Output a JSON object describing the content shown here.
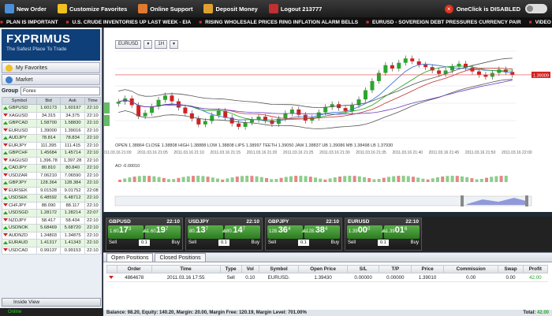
{
  "topbar": {
    "items": [
      {
        "label": "New Order",
        "icon": "new-order-icon",
        "color": "#4a8fd8"
      },
      {
        "label": "Customize Favorites",
        "icon": "star-icon",
        "color": "#f0c020"
      },
      {
        "label": "Online Support",
        "icon": "support-icon",
        "color": "#e07a30"
      },
      {
        "label": "Deposit Money",
        "icon": "deposit-icon",
        "color": "#e0a030"
      },
      {
        "label": "Logout 213777",
        "icon": "logout-icon",
        "color": "#c03030"
      }
    ],
    "oneclick_status": "OneClick is DISABLED"
  },
  "ticker": [
    "PLAN IS IMPORTANT",
    "U.S. CRUDE INVENTORIES UP LAST WEEK - EIA",
    "RISING WHOLESALE PRICES RING INFLATION ALARM BELLS",
    "EURUSD - SOVEREIGN DEBT PRESSURES CURRENCY PAIR",
    "VIDEO HOW SUBMIT YOUR STORY TO FO"
  ],
  "sidebar": {
    "brand": "FXPRIMUS",
    "tagline": "The Safest Place To Trade",
    "favorites_label": "My Favorites",
    "market_label": "Market",
    "group_label": "Group",
    "group_value": "Forex",
    "columns": [
      "Symbol",
      "Bid",
      "Ask",
      "Time"
    ],
    "rows": [
      {
        "dir": "up",
        "symbol": "GBPUSD",
        "bid": "1.60173",
        "ask": "1.60197",
        "time": "22:10"
      },
      {
        "dir": "down",
        "symbol": "XAGUSD",
        "bid": "34.315",
        "ask": "34.375",
        "time": "22:10"
      },
      {
        "dir": "up",
        "symbol": "GBPCAD",
        "bid": "1.58700",
        "ask": "1.58830",
        "time": "22:10"
      },
      {
        "dir": "down",
        "symbol": "EURUSD",
        "bid": "1.39000",
        "ask": "1.39016",
        "time": "22:10"
      },
      {
        "dir": "up",
        "symbol": "AUDJPY",
        "bid": "78.814",
        "ask": "78.834",
        "time": "22:10"
      },
      {
        "dir": "down",
        "symbol": "EURJPY",
        "bid": "111.395",
        "ask": "111.415",
        "time": "22:10"
      },
      {
        "dir": "up",
        "symbol": "GBPCHF",
        "bid": "1.45684",
        "ask": "1.45714",
        "time": "22:10"
      },
      {
        "dir": "down",
        "symbol": "XAGUSD",
        "bid": "1,396.78",
        "ask": "1,397.28",
        "time": "22:10"
      },
      {
        "dir": "up",
        "symbol": "CADJPY",
        "bid": "80.810",
        "ask": "80.840",
        "time": "22:10"
      },
      {
        "dir": "down",
        "symbol": "USDZAR",
        "bid": "7.06210",
        "ask": "7.06590",
        "time": "22:10"
      },
      {
        "dir": "up",
        "symbol": "GBPJPY",
        "bid": "128.364",
        "ask": "128.384",
        "time": "22:10"
      },
      {
        "dir": "down",
        "symbol": "EURSEK",
        "bid": "9.01528",
        "ask": "9.01752",
        "time": "22:08"
      },
      {
        "dir": "up",
        "symbol": "USDSEK",
        "bid": "6.48592",
        "ask": "6.48712",
        "time": "22:10"
      },
      {
        "dir": "down",
        "symbol": "CHFJPY",
        "bid": "88.090",
        "ask": "88.117",
        "time": "22:10"
      },
      {
        "dir": "up",
        "symbol": "USDSGD",
        "bid": "1.28172",
        "ask": "1.28214",
        "time": "22:07"
      },
      {
        "dir": "down",
        "symbol": "NZDJPY",
        "bid": "58.417",
        "ask": "58.434",
        "time": "22:10"
      },
      {
        "dir": "up",
        "symbol": "USDNOK",
        "bid": "5.68469",
        "ask": "5.68720",
        "time": "22:10"
      },
      {
        "dir": "down",
        "symbol": "AUDNZD",
        "bid": "1.34803",
        "ask": "1.34875",
        "time": "22:10"
      },
      {
        "dir": "up",
        "symbol": "EURAUD",
        "bid": "1.41317",
        "ask": "1.41343",
        "time": "22:10"
      },
      {
        "dir": "down",
        "symbol": "USDCAD",
        "bid": "0.99137",
        "ask": "0.99153",
        "time": "22:10"
      }
    ],
    "inside_view_label": "Inside View",
    "online_label": "Online"
  },
  "chart": {
    "symbol_dd": "EURUSD",
    "period_dd": "1H",
    "ohlc_text": "OPEN 1.38864  CLOSE 1.38808  HIGH 1.38888  LOW 1.38808  LIPS 1.38997  TEETH 1.39050  JAW 1.38837  UB 1.39086  MB 1.38498  LB 1.37930",
    "ao_text": "AO -0.00010",
    "price_label": "1.39009",
    "time_labels": [
      "2011.03.16 21:00",
      "2011.03.16 21:05",
      "2011.03.16 21:10",
      "2011.03.16 21:15",
      "2011.03.16 21:20",
      "2011.03.16 21:25",
      "2011.03.16 21:30",
      "2011.03.16 21:35",
      "2011.03.16 21:40",
      "2011.03.16 21:45",
      "2011.03.16 21:50",
      "2011.03.16 22:00"
    ]
  },
  "tiles": [
    {
      "pair": "GBPUSD",
      "time": "22:10",
      "sell_pre": "1.60",
      "sell_big": "17",
      "sell_sup": "3",
      "buy_pre": "1.60",
      "buy_big": "19",
      "buy_sup": "7",
      "lot": "0.1"
    },
    {
      "pair": "USDJPY",
      "time": "22:10",
      "sell_pre": "80.",
      "sell_big": "13",
      "sell_sup": "7",
      "buy_pre": "80.",
      "buy_big": "14",
      "buy_sup": "7",
      "lot": "0.1"
    },
    {
      "pair": "GBPJPY",
      "time": "22:10",
      "sell_pre": "128.",
      "sell_big": "36",
      "sell_sup": "4",
      "buy_pre": "128.",
      "buy_big": "38",
      "buy_sup": "4",
      "lot": "0.1"
    },
    {
      "pair": "EURUSD",
      "time": "22:10",
      "sell_pre": "1.39",
      "sell_big": "00",
      "sell_sup": "0",
      "buy_pre": "1.39",
      "buy_big": "01",
      "buy_sup": "6",
      "lot": "0.1"
    }
  ],
  "tile_labels": {
    "sell": "Sell",
    "buy": "Buy"
  },
  "positions": {
    "tabs": [
      "Open Positions",
      "Closed Positions"
    ],
    "columns": [
      "",
      "Order",
      "Time",
      "Type",
      "Vol",
      "Symbol",
      "Open Price",
      "S/L",
      "T/P",
      "Price",
      "Commission",
      "Swap",
      "Profit"
    ],
    "rows": [
      {
        "order": "4864678",
        "time": "2011.03.16 17:55",
        "type": "Sell",
        "vol": "0.10",
        "symbol": "EURUSD.",
        "open": "1.39430",
        "sl": "0.00000",
        "tp": "0.00000",
        "price": "1.39010",
        "commission": "0.00",
        "swap": "0.00",
        "profit": "42.00"
      }
    ]
  },
  "status": {
    "summary": "Balance: 98.20, Equity: 140.20, Margin: 20.00, Margin Free: 120.19, Margin Level: 701.00%",
    "total_label": "Total:",
    "total_value": "42.00"
  },
  "chart_data": {
    "type": "candlestick",
    "symbol": "EURUSD",
    "values": [
      1.3845,
      1.3852,
      1.3838,
      1.3815,
      1.3822,
      1.3835,
      1.3849,
      1.3858,
      1.3846,
      1.3833,
      1.3821,
      1.381,
      1.3798,
      1.3805,
      1.3817,
      1.3826,
      1.3812,
      1.38,
      1.3793,
      1.3802,
      1.3808,
      1.3814,
      1.3806,
      1.3799,
      1.381,
      1.3821,
      1.3829,
      1.3818,
      1.3806,
      1.3812,
      1.3823,
      1.3834,
      1.384,
      1.3832,
      1.3826,
      1.3838,
      1.385,
      1.3869,
      1.3888,
      1.3905,
      1.3921,
      1.3914,
      1.3926,
      1.3935,
      1.3929,
      1.3922,
      1.3917,
      1.391,
      1.3903,
      1.391,
      1.3918,
      1.3924,
      1.3916,
      1.3908,
      1.3901,
      1.3897,
      1.3905,
      1.3912,
      1.3907,
      1.3901
    ]
  }
}
